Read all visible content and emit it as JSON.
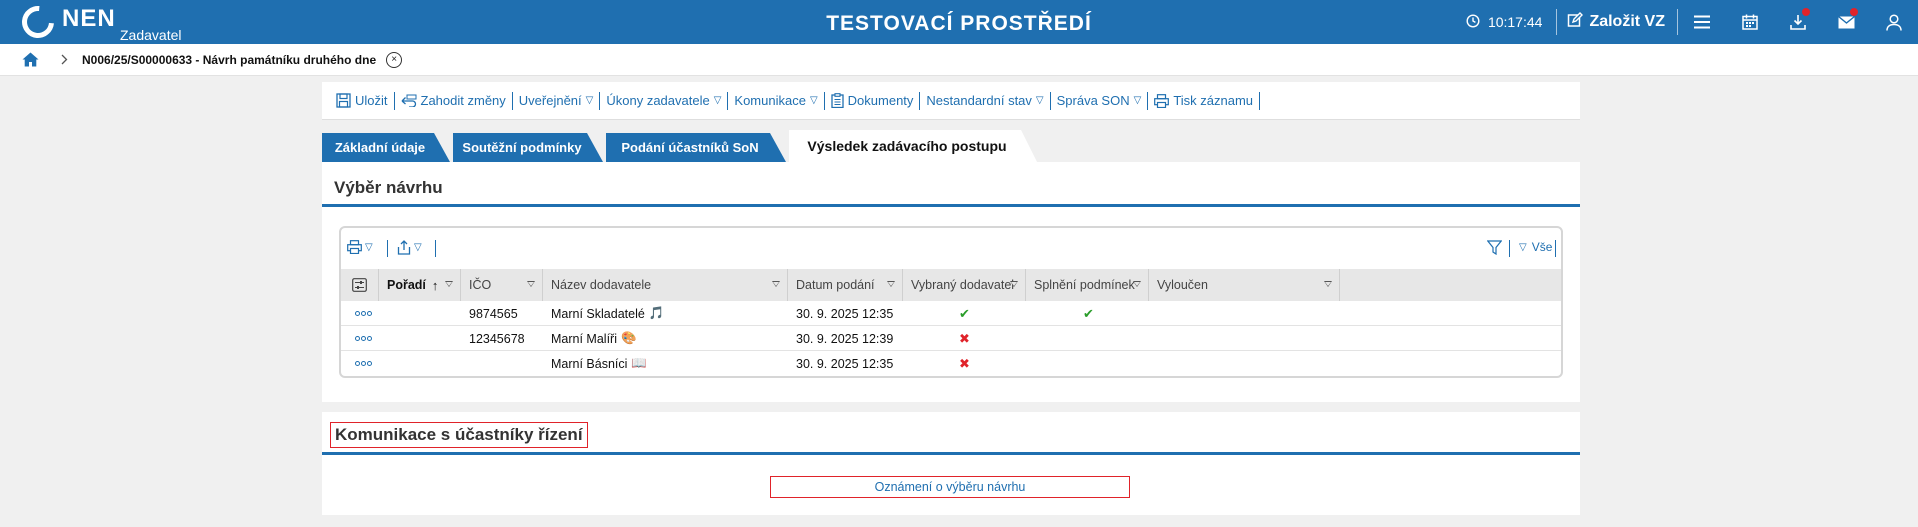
{
  "header": {
    "logo_text": "NEN",
    "role": "Zadavatel",
    "environment_title": "TESTOVACÍ PROSTŘEDÍ",
    "time": "10:17:44",
    "create_button": "Založit VZ",
    "icons": [
      "clock-icon",
      "edit-icon",
      "menu-icon",
      "calendar-icon",
      "download-icon",
      "mail-icon",
      "user-icon"
    ],
    "badge_color": "#e0232a",
    "brand_color": "#1f6fb0"
  },
  "breadcrumb": {
    "title": "N006/25/S00000633 - Návrh památníku druhého dne",
    "close_glyph": "×"
  },
  "toolbar": {
    "items": [
      {
        "label": "Uložit",
        "icon": "save-icon",
        "dropdown": false
      },
      {
        "label": "Zahodit změny",
        "icon": "undo-icon",
        "dropdown": false
      },
      {
        "label": "Uveřejnění",
        "icon": "",
        "dropdown": true
      },
      {
        "label": "Úkony zadavatele",
        "icon": "",
        "dropdown": true
      },
      {
        "label": "Komunikace",
        "icon": "",
        "dropdown": true
      },
      {
        "label": "Dokumenty",
        "icon": "documents-icon",
        "dropdown": false
      },
      {
        "label": "Nestandardní stav",
        "icon": "",
        "dropdown": true
      },
      {
        "label": "Správa SON",
        "icon": "",
        "dropdown": true
      },
      {
        "label": "Tisk záznamu",
        "icon": "print-icon",
        "dropdown": false
      }
    ]
  },
  "tabs": [
    {
      "label": "Základní údaje",
      "active": false
    },
    {
      "label": "Soutěžní podmínky",
      "active": false
    },
    {
      "label": "Podání účastníků SoN",
      "active": false
    },
    {
      "label": "Výsledek zadávacího postupu",
      "active": true
    }
  ],
  "selection": {
    "title": "Výběr návrhu",
    "grid_tools": {
      "filter_all_label": "Vše"
    },
    "columns": [
      "Pořadí",
      "IČO",
      "Název dodavatele",
      "Datum podání",
      "Vybraný dodavatel",
      "Splnění podmínek",
      "Vyloučen"
    ],
    "rows": [
      {
        "ico": "9874565",
        "name": "Marní Skladatelé",
        "emoji": "🎵",
        "date": "30. 9. 2025 12:35",
        "selected": "✔",
        "conditions": "✔",
        "excluded": ""
      },
      {
        "ico": "12345678",
        "name": "Marní Malíři",
        "emoji": "🎨",
        "date": "30. 9. 2025 12:39",
        "selected": "✖",
        "conditions": "",
        "excluded": ""
      },
      {
        "ico": "",
        "name": "Marní Básníci",
        "emoji": "📖",
        "date": "30. 9. 2025 12:35",
        "selected": "✖",
        "conditions": "",
        "excluded": ""
      }
    ]
  },
  "communication": {
    "title": "Komunikace s účastníky řízení",
    "notice_button": "Oznámení o výběru návrhu"
  }
}
